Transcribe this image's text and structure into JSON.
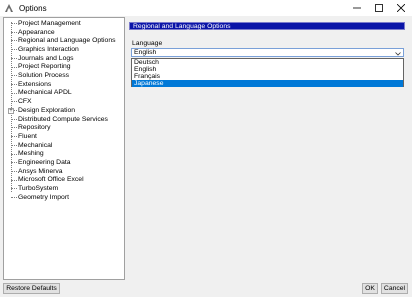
{
  "window": {
    "title": "Options"
  },
  "tree": {
    "items": [
      {
        "label": "Project Management",
        "expandable": false
      },
      {
        "label": "Appearance",
        "expandable": false
      },
      {
        "label": "Regional and Language Options",
        "expandable": false
      },
      {
        "label": "Graphics Interaction",
        "expandable": false
      },
      {
        "label": "Journals and Logs",
        "expandable": false
      },
      {
        "label": "Project Reporting",
        "expandable": false
      },
      {
        "label": "Solution Process",
        "expandable": false
      },
      {
        "label": "Extensions",
        "expandable": false
      },
      {
        "label": "Mechanical APDL",
        "expandable": false
      },
      {
        "label": "CFX",
        "expandable": false
      },
      {
        "label": "Design Exploration",
        "expandable": true
      },
      {
        "label": "Distributed Compute Services",
        "expandable": false
      },
      {
        "label": "Repository",
        "expandable": false
      },
      {
        "label": "Fluent",
        "expandable": false
      },
      {
        "label": "Mechanical",
        "expandable": false
      },
      {
        "label": "Meshing",
        "expandable": false
      },
      {
        "label": "Engineering Data",
        "expandable": false
      },
      {
        "label": "Ansys Minerva",
        "expandable": false
      },
      {
        "label": "Microsoft Office Excel",
        "expandable": false
      },
      {
        "label": "TurboSystem",
        "expandable": false
      },
      {
        "label": "Geometry Import",
        "expandable": false
      }
    ]
  },
  "panel": {
    "header": "Regional and Language Options",
    "language_label": "Language",
    "language_value": "English",
    "language_options": [
      {
        "label": "Deutsch",
        "highlighted": false
      },
      {
        "label": "English",
        "highlighted": false
      },
      {
        "label": "Français",
        "highlighted": false
      },
      {
        "label": "Japanese",
        "highlighted": true
      }
    ]
  },
  "buttons": {
    "restore_defaults": "Restore Defaults",
    "ok": "OK",
    "cancel": "Cancel"
  },
  "colors": {
    "header_bg": "#0a14a8",
    "selected_option_bg": "#0078d7"
  }
}
